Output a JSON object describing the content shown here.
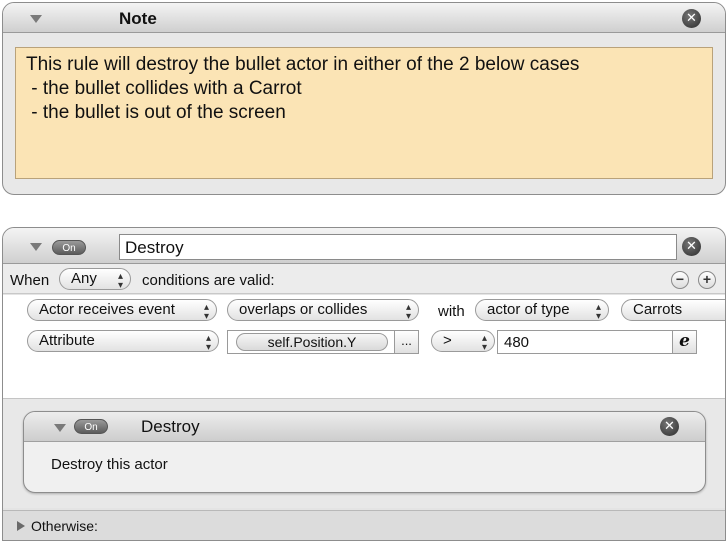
{
  "note": {
    "title": "Note",
    "close_glyph": "✕",
    "lines": [
      "This rule will destroy the bullet actor in either of the 2 below cases",
      " - the bullet collides with a Carrot",
      " - the bullet is out of the screen"
    ],
    "bg_color": "#fbe4b5"
  },
  "rule": {
    "on_label": "On",
    "name": "Destroy",
    "close_glyph": "✕",
    "when_label": "When",
    "match_value": "Any",
    "conditions_label": "conditions are valid:",
    "minus_glyph": "−",
    "plus_glyph": "+",
    "condition1": {
      "type": "Actor receives event",
      "event": "overlaps or collides",
      "with_label": "with",
      "target_kind": "actor of type",
      "target": "Carrots"
    },
    "condition2": {
      "type": "Attribute",
      "attribute": "self.Position.Y",
      "ellipsis": "...",
      "operator": ">",
      "value": "480",
      "expr_glyph": "e"
    }
  },
  "behavior": {
    "on_label": "On",
    "title": "Destroy",
    "close_glyph": "✕",
    "body": "Destroy this actor"
  },
  "otherwise_label": "Otherwise:"
}
